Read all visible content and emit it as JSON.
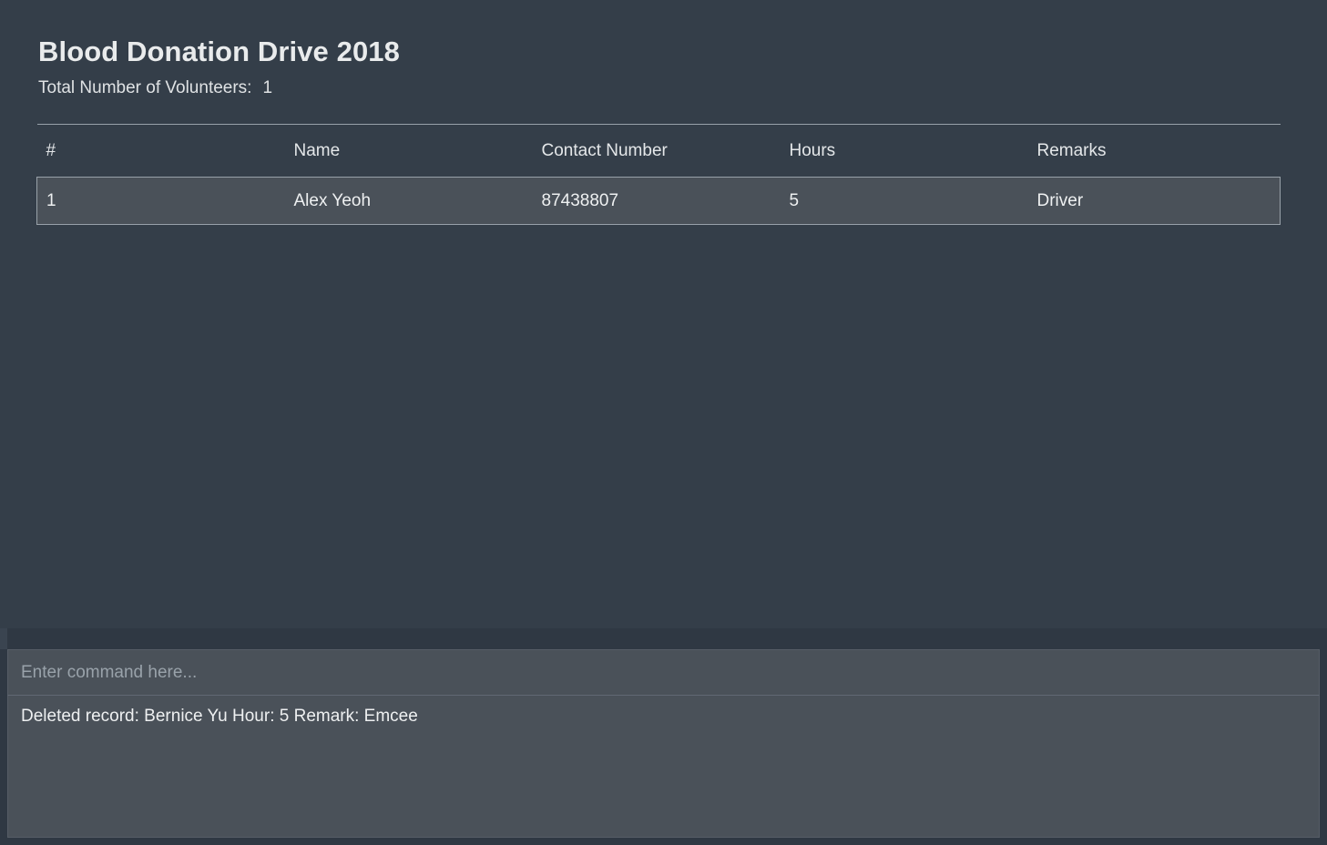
{
  "app": {
    "window_title": "Blood Donation Drive 2018"
  },
  "header": {
    "title": "Blood Donation Drive 2018",
    "summary_label": "Total Number of Volunteers:",
    "summary_count": "1"
  },
  "table": {
    "columns": [
      "#",
      "Name",
      "Contact Number",
      "Hours",
      "Remarks"
    ],
    "rows": [
      {
        "index": "1",
        "name": "Alex Yeoh",
        "contact": "87438807",
        "hours": "5",
        "remarks": "Driver"
      }
    ]
  },
  "command": {
    "placeholder": "Enter command here...",
    "value": ""
  },
  "result": {
    "message": "Deleted record: Bernice Yu Hour: 5 Remark: Emcee"
  },
  "colors": {
    "background": "#343e49",
    "panel_gap": "#2f3843",
    "row_highlight": "#4a5159",
    "rule": "#98a1a9",
    "text_primary": "#e9ebec",
    "text_placeholder": "#99a2aa"
  }
}
